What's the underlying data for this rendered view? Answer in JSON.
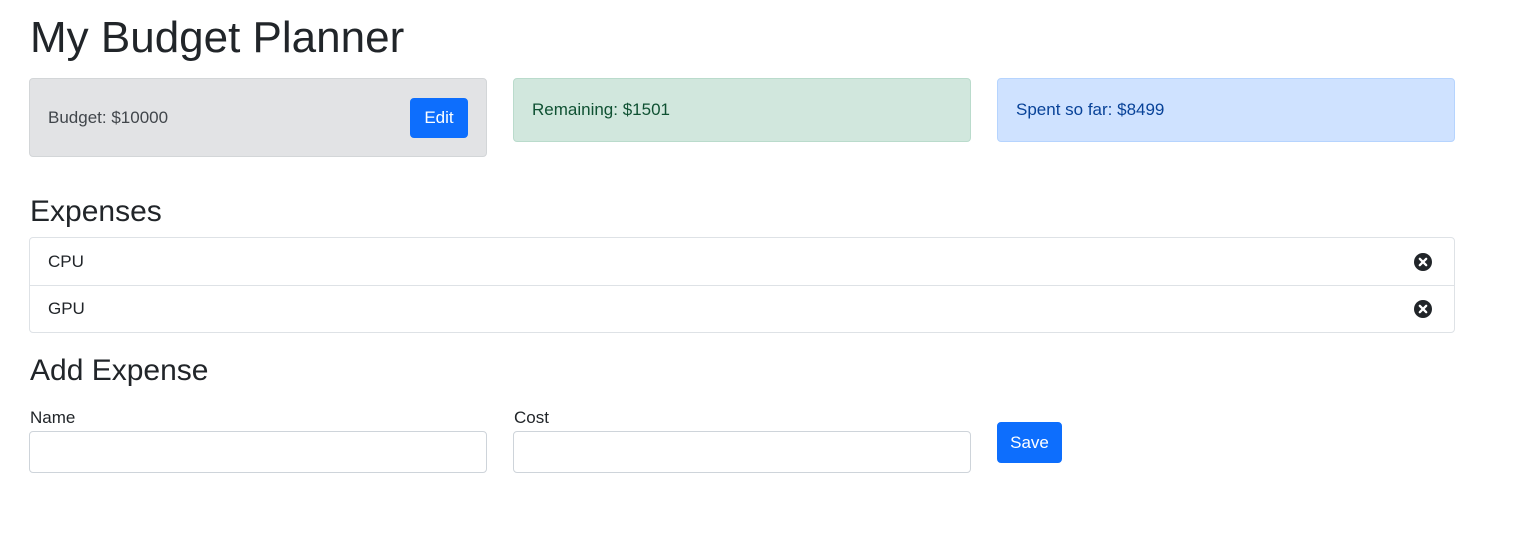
{
  "page": {
    "title": "My Budget Planner"
  },
  "budget": {
    "label": "Budget: $10000",
    "edit_label": "Edit"
  },
  "remaining": {
    "label": "Remaining: $1501"
  },
  "spent": {
    "label": "Spent so far: $8499"
  },
  "expenses": {
    "title": "Expenses",
    "items": [
      {
        "name": "CPU",
        "icon": "close-circle-icon"
      },
      {
        "name": "GPU",
        "icon": "close-circle-icon"
      }
    ]
  },
  "add_expense": {
    "title": "Add Expense",
    "name_label": "Name",
    "name_value": "",
    "cost_label": "Cost",
    "cost_value": "",
    "save_label": "Save"
  },
  "colors": {
    "primary": "#0d6efd",
    "budget_bg": "#e2e3e5",
    "remaining_bg": "#d1e7dd",
    "spent_bg": "#cfe2ff"
  }
}
